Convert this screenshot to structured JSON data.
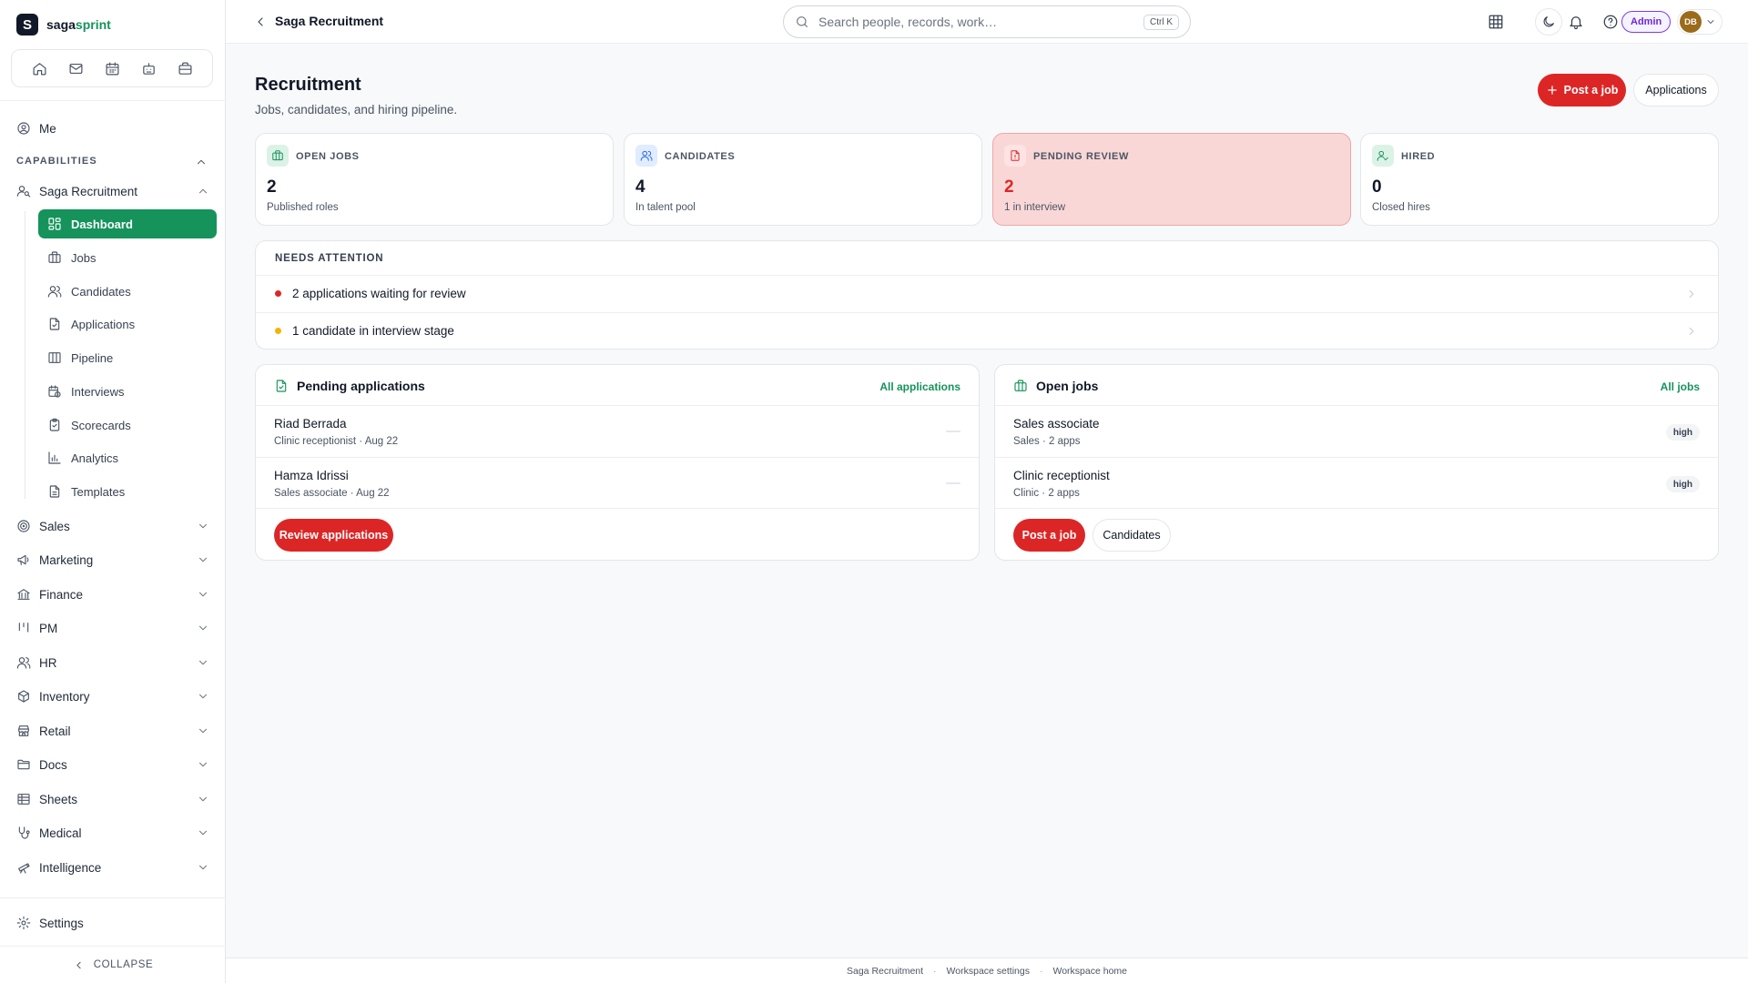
{
  "brand": {
    "logo_letter": "S",
    "name_main": "saga",
    "name_accent": "sprint"
  },
  "quick_bar": [
    "home-icon",
    "mail-icon",
    "calendar-icon",
    "robot-icon",
    "briefcase-icon"
  ],
  "sidebar": {
    "me_label": "Me",
    "section_label": "CAPABILITIES",
    "active_group": "Saga Recruitment",
    "sub_items": [
      {
        "label": "Dashboard",
        "icon": "dashboard-icon",
        "active": true
      },
      {
        "label": "Jobs",
        "icon": "briefcase-icon"
      },
      {
        "label": "Candidates",
        "icon": "users-icon"
      },
      {
        "label": "Applications",
        "icon": "file-check-icon"
      },
      {
        "label": "Pipeline",
        "icon": "columns-icon"
      },
      {
        "label": "Interviews",
        "icon": "calendar-clock-icon"
      },
      {
        "label": "Scorecards",
        "icon": "clipboard-icon"
      },
      {
        "label": "Analytics",
        "icon": "bar-chart-icon"
      },
      {
        "label": "Templates",
        "icon": "file-text-icon"
      }
    ],
    "groups": [
      {
        "label": "Sales",
        "icon": "target-icon"
      },
      {
        "label": "Marketing",
        "icon": "megaphone-icon"
      },
      {
        "label": "Finance",
        "icon": "bank-icon"
      },
      {
        "label": "PM",
        "icon": "kanban-icon"
      },
      {
        "label": "HR",
        "icon": "people-icon"
      },
      {
        "label": "Inventory",
        "icon": "box-icon"
      },
      {
        "label": "Retail",
        "icon": "store-icon"
      },
      {
        "label": "Docs",
        "icon": "folder-icon"
      },
      {
        "label": "Sheets",
        "icon": "table-icon"
      },
      {
        "label": "Medical",
        "icon": "stethoscope-icon"
      },
      {
        "label": "Intelligence",
        "icon": "telescope-icon"
      }
    ],
    "settings_label": "Settings",
    "collapse_label": "COLLAPSE"
  },
  "topbar": {
    "title": "Saga Recruitment",
    "search_placeholder": "Search people, records, work…",
    "search_value": "",
    "shortcut": "Ctrl K",
    "role_badge": "Admin",
    "avatar_initials": "DB"
  },
  "page": {
    "title": "Recruitment",
    "subtitle": "Jobs, candidates, and hiring pipeline.",
    "post_job_label": "Post a job",
    "applications_label": "Applications"
  },
  "stats": [
    {
      "label": "OPEN JOBS",
      "value": "2",
      "note": "Published roles",
      "icon": "briefcase-icon",
      "icon_color": "#15935b",
      "icon_bg": "#dcf2e6"
    },
    {
      "label": "CANDIDATES",
      "value": "4",
      "note": "In talent pool",
      "icon": "users-icon",
      "icon_color": "#2563eb",
      "icon_bg": "#e0ecff"
    },
    {
      "label": "PENDING REVIEW",
      "value": "2",
      "note": "1 in interview",
      "icon": "file-alert-icon",
      "icon_color": "#dc2626",
      "icon_bg": "#fde3e3"
    },
    {
      "label": "HIRED",
      "value": "0",
      "note": "Closed hires",
      "icon": "user-check-icon",
      "icon_color": "#15935b",
      "icon_bg": "#dcf2e6"
    }
  ],
  "attention": {
    "title": "NEEDS ATTENTION",
    "items": [
      {
        "text": "2 applications waiting for review",
        "color": "#dc2626"
      },
      {
        "text": "1 candidate in interview stage",
        "color": "#f5b400"
      }
    ]
  },
  "pending_panel": {
    "title": "Pending applications",
    "link": "All applications",
    "rows": [
      {
        "name": "Riad Berrada",
        "sub": "Clinic receptionist · Aug 22"
      },
      {
        "name": "Hamza Idrissi",
        "sub": "Sales associate · Aug 22"
      }
    ],
    "primary_action": "Review applications"
  },
  "jobs_panel": {
    "title": "Open jobs",
    "link": "All jobs",
    "rows": [
      {
        "name": "Sales associate",
        "sub": "Sales · 2 apps",
        "tag": "high"
      },
      {
        "name": "Clinic receptionist",
        "sub": "Clinic · 2 apps",
        "tag": "high"
      }
    ],
    "primary_action": "Post a job",
    "secondary_action": "Candidates"
  },
  "footer": {
    "links": [
      "Saga Recruitment",
      "Workspace settings",
      "Workspace home"
    ],
    "separator": "·"
  },
  "colors": {
    "accent": "#15935b",
    "danger": "#dc2626",
    "warning": "#f5b400",
    "admin": "#6d28d9"
  }
}
